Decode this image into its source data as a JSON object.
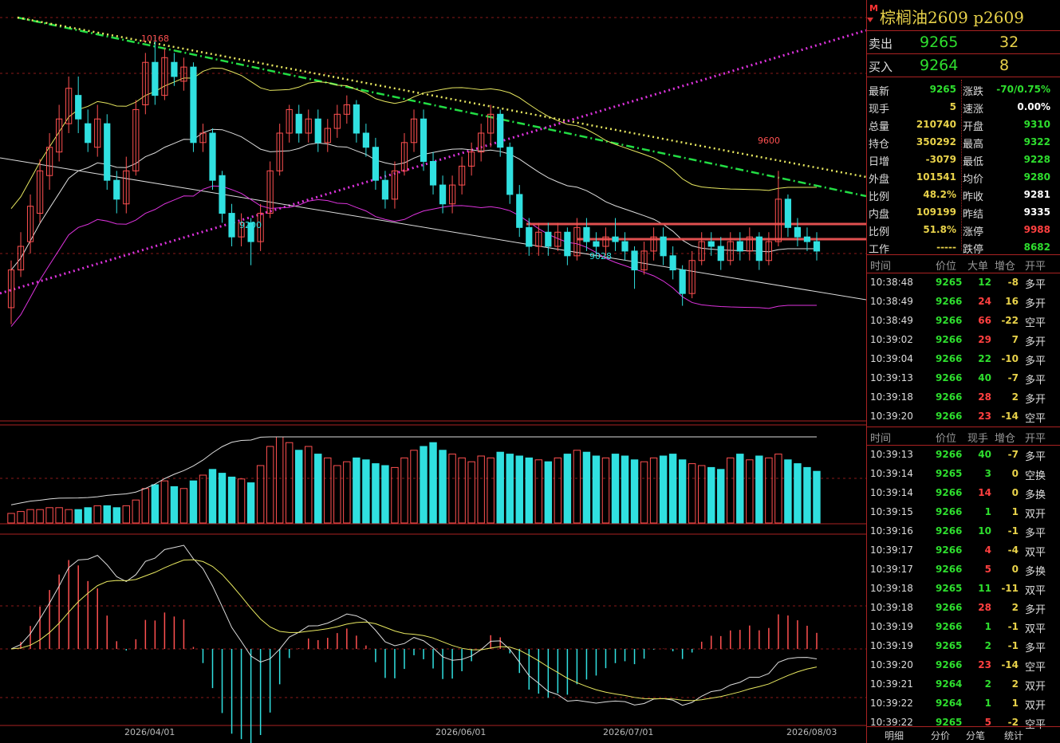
{
  "header": {
    "mark": "M",
    "title": "棕榈油2609  p2609"
  },
  "order_book": {
    "sell": {
      "label": "卖出",
      "price": "9265",
      "qty": "32"
    },
    "buy": {
      "label": "买入",
      "price": "9264",
      "qty": "8"
    }
  },
  "stats_left": [
    {
      "k": "最新",
      "v": "9265",
      "color": "#2ede2e"
    },
    {
      "k": "现手",
      "v": "5",
      "color": "#e8d24a"
    },
    {
      "k": "总量",
      "v": "210740",
      "color": "#e8d24a"
    },
    {
      "k": "持仓",
      "v": "350292",
      "color": "#e8d24a"
    },
    {
      "k": "日增",
      "v": "-3079",
      "color": "#e8d24a"
    },
    {
      "k": "外盘",
      "v": "101541",
      "color": "#e8d24a"
    },
    {
      "k": "比例",
      "v": "48.2%",
      "color": "#e8d24a"
    },
    {
      "k": "内盘",
      "v": "109199",
      "color": "#e8d24a"
    },
    {
      "k": "比例",
      "v": "51.8%",
      "color": "#e8d24a"
    },
    {
      "k": "工作",
      "v": "-----",
      "color": "#e8d24a"
    }
  ],
  "stats_right": [
    {
      "k": "涨跌",
      "v": "-70/0.75%",
      "color": "#2ede2e"
    },
    {
      "k": "速涨",
      "v": "0.00%",
      "color": "#ffffff"
    },
    {
      "k": "开盘",
      "v": "9310",
      "color": "#2ede2e"
    },
    {
      "k": "最高",
      "v": "9322",
      "color": "#2ede2e"
    },
    {
      "k": "最低",
      "v": "9228",
      "color": "#2ede2e"
    },
    {
      "k": "均价",
      "v": "9280",
      "color": "#2ede2e"
    },
    {
      "k": "昨收",
      "v": "9281",
      "color": "#ffffff"
    },
    {
      "k": "昨结",
      "v": "9335",
      "color": "#ffffff"
    },
    {
      "k": "涨停",
      "v": "9988",
      "color": "#ff4040"
    },
    {
      "k": "跌停",
      "v": "8682",
      "color": "#2ede2e"
    }
  ],
  "big_orders": {
    "headers": [
      "时间",
      "价位",
      "大单",
      "增仓",
      "开平"
    ],
    "rows": [
      {
        "time": "10:38:48",
        "price": "9265",
        "vol": "12",
        "chg": "-8",
        "type": "多平",
        "volc": "#2ede2e",
        "chgc": "#e8d24a"
      },
      {
        "time": "10:38:49",
        "price": "9266",
        "vol": "24",
        "chg": "16",
        "type": "多开",
        "volc": "#ff4040",
        "chgc": "#e8d24a"
      },
      {
        "time": "10:38:49",
        "price": "9266",
        "vol": "66",
        "chg": "-22",
        "type": "空平",
        "volc": "#ff4040",
        "chgc": "#e8d24a"
      },
      {
        "time": "10:39:02",
        "price": "9266",
        "vol": "29",
        "chg": "7",
        "type": "多开",
        "volc": "#ff4040",
        "chgc": "#e8d24a"
      },
      {
        "time": "10:39:04",
        "price": "9266",
        "vol": "22",
        "chg": "-10",
        "type": "多平",
        "volc": "#2ede2e",
        "chgc": "#e8d24a"
      },
      {
        "time": "10:39:13",
        "price": "9266",
        "vol": "40",
        "chg": "-7",
        "type": "多平",
        "volc": "#2ede2e",
        "chgc": "#e8d24a"
      },
      {
        "time": "10:39:18",
        "price": "9266",
        "vol": "28",
        "chg": "2",
        "type": "多开",
        "volc": "#ff4040",
        "chgc": "#e8d24a"
      },
      {
        "time": "10:39:20",
        "price": "9266",
        "vol": "23",
        "chg": "-14",
        "type": "空平",
        "volc": "#ff4040",
        "chgc": "#e8d24a"
      }
    ]
  },
  "ticks": {
    "headers": [
      "时间",
      "价位",
      "现手",
      "增仓",
      "开平"
    ],
    "rows": [
      {
        "time": "10:39:13",
        "price": "9266",
        "vol": "40",
        "chg": "-7",
        "type": "多平",
        "volc": "#2ede2e"
      },
      {
        "time": "10:39:14",
        "price": "9265",
        "vol": "3",
        "chg": "0",
        "type": "空换",
        "volc": "#2ede2e"
      },
      {
        "time": "10:39:14",
        "price": "9266",
        "vol": "14",
        "chg": "0",
        "type": "多换",
        "volc": "#ff4040"
      },
      {
        "time": "10:39:15",
        "price": "9266",
        "vol": "1",
        "chg": "1",
        "type": "双开",
        "volc": "#2ede2e"
      },
      {
        "time": "10:39:16",
        "price": "9266",
        "vol": "10",
        "chg": "-1",
        "type": "多平",
        "volc": "#2ede2e"
      },
      {
        "time": "10:39:17",
        "price": "9266",
        "vol": "4",
        "chg": "-4",
        "type": "双平",
        "volc": "#ff4040"
      },
      {
        "time": "10:39:17",
        "price": "9266",
        "vol": "5",
        "chg": "0",
        "type": "多换",
        "volc": "#ff4040"
      },
      {
        "time": "10:39:18",
        "price": "9265",
        "vol": "11",
        "chg": "-11",
        "type": "双平",
        "volc": "#2ede2e"
      },
      {
        "time": "10:39:18",
        "price": "9266",
        "vol": "28",
        "chg": "2",
        "type": "多开",
        "volc": "#ff4040"
      },
      {
        "time": "10:39:19",
        "price": "9266",
        "vol": "1",
        "chg": "-1",
        "type": "双平",
        "volc": "#2ede2e"
      },
      {
        "time": "10:39:19",
        "price": "9265",
        "vol": "2",
        "chg": "-1",
        "type": "多平",
        "volc": "#2ede2e"
      },
      {
        "time": "10:39:20",
        "price": "9266",
        "vol": "23",
        "chg": "-14",
        "type": "空平",
        "volc": "#ff4040"
      },
      {
        "time": "10:39:21",
        "price": "9264",
        "vol": "2",
        "chg": "2",
        "type": "双开",
        "volc": "#2ede2e"
      },
      {
        "time": "10:39:22",
        "price": "9264",
        "vol": "1",
        "chg": "1",
        "type": "双开",
        "volc": "#2ede2e"
      },
      {
        "time": "10:39:22",
        "price": "9265",
        "vol": "5",
        "chg": "-2",
        "type": "空平",
        "volc": "#ff4040"
      }
    ]
  },
  "tabs": [
    "明细",
    "分价",
    "分笔",
    "统计"
  ],
  "chart_labels": {
    "high_a": "10168",
    "high_b": "9600",
    "low_a": "9200",
    "low_b": "9028"
  },
  "dates": [
    "2026/04/01",
    "2026/06/01",
    "2026/07/01",
    "2026/08/03"
  ],
  "chart_data": {
    "type": "candlestick",
    "price_range": [
      8550,
      10250
    ],
    "candles": [
      [
        9020,
        9180,
        8950,
        9220
      ],
      [
        9180,
        9280,
        9150,
        9340
      ],
      [
        9300,
        9450,
        9250,
        9500
      ],
      [
        9420,
        9600,
        9380,
        9650
      ],
      [
        9580,
        9700,
        9520,
        9760
      ],
      [
        9680,
        9820,
        9640,
        9880
      ],
      [
        9800,
        9950,
        9760,
        10000
      ],
      [
        9920,
        9820,
        9760,
        10000
      ],
      [
        9800,
        9720,
        9680,
        9860
      ],
      [
        9700,
        9820,
        9660,
        9880
      ],
      [
        9800,
        9560,
        9520,
        9840
      ],
      [
        9560,
        9480,
        9420,
        9600
      ],
      [
        9460,
        9600,
        9420,
        9660
      ],
      [
        9600,
        9860,
        9580,
        9900
      ],
      [
        9880,
        10060,
        9840,
        10100
      ],
      [
        10060,
        9920,
        9880,
        10168
      ],
      [
        9920,
        10080,
        9900,
        10120
      ],
      [
        10060,
        10000,
        9960,
        10100
      ],
      [
        9980,
        10040,
        9940,
        10080
      ],
      [
        10040,
        9720,
        9680,
        10060
      ],
      [
        9720,
        9760,
        9680,
        9800
      ],
      [
        9760,
        9560,
        9520,
        9780
      ],
      [
        9580,
        9420,
        9380,
        9600
      ],
      [
        9420,
        9320,
        9280,
        9460
      ],
      [
        9320,
        9380,
        9280,
        9420
      ],
      [
        9380,
        9300,
        9200,
        9400
      ],
      [
        9300,
        9420,
        9260,
        9460
      ],
      [
        9420,
        9600,
        9400,
        9640
      ],
      [
        9600,
        9760,
        9580,
        9800
      ],
      [
        9760,
        9860,
        9720,
        9880
      ],
      [
        9840,
        9760,
        9720,
        9880
      ],
      [
        9760,
        9820,
        9720,
        9860
      ],
      [
        9820,
        9720,
        9680,
        9860
      ],
      [
        9720,
        9780,
        9680,
        9820
      ],
      [
        9780,
        9840,
        9740,
        9880
      ],
      [
        9840,
        9880,
        9800,
        9920
      ],
      [
        9880,
        9760,
        9720,
        9900
      ],
      [
        9760,
        9700,
        9660,
        9800
      ],
      [
        9700,
        9560,
        9520,
        9740
      ],
      [
        9560,
        9480,
        9440,
        9600
      ],
      [
        9480,
        9600,
        9440,
        9640
      ],
      [
        9600,
        9720,
        9580,
        9760
      ],
      [
        9720,
        9820,
        9680,
        9860
      ],
      [
        9820,
        9640,
        9600,
        9860
      ],
      [
        9640,
        9540,
        9500,
        9680
      ],
      [
        9540,
        9460,
        9420,
        9580
      ],
      [
        9460,
        9540,
        9420,
        9580
      ],
      [
        9540,
        9620,
        9500,
        9660
      ],
      [
        9620,
        9680,
        9580,
        9720
      ],
      [
        9680,
        9760,
        9640,
        9800
      ],
      [
        9760,
        9840,
        9700,
        9880
      ],
      [
        9840,
        9700,
        9660,
        9860
      ],
      [
        9700,
        9500,
        9460,
        9720
      ],
      [
        9500,
        9360,
        9320,
        9540
      ],
      [
        9360,
        9280,
        9240,
        9400
      ],
      [
        9280,
        9340,
        9240,
        9380
      ],
      [
        9340,
        9280,
        9240,
        9380
      ],
      [
        9280,
        9340,
        9260,
        9380
      ],
      [
        9340,
        9240,
        9200,
        9360
      ],
      [
        9240,
        9360,
        9220,
        9400
      ],
      [
        9360,
        9300,
        9260,
        9400
      ],
      [
        9300,
        9280,
        9240,
        9340
      ],
      [
        9280,
        9320,
        9240,
        9360
      ],
      [
        9320,
        9300,
        9260,
        9400
      ],
      [
        9300,
        9260,
        9220,
        9340
      ],
      [
        9260,
        9180,
        9100,
        9280
      ],
      [
        9180,
        9260,
        9160,
        9300
      ],
      [
        9260,
        9320,
        9220,
        9360
      ],
      [
        9320,
        9240,
        9200,
        9360
      ],
      [
        9240,
        9180,
        9140,
        9280
      ],
      [
        9180,
        9080,
        9028,
        9200
      ],
      [
        9080,
        9220,
        9060,
        9260
      ],
      [
        9220,
        9300,
        9200,
        9340
      ],
      [
        9300,
        9280,
        9240,
        9340
      ],
      [
        9280,
        9220,
        9180,
        9320
      ],
      [
        9220,
        9300,
        9200,
        9340
      ],
      [
        9300,
        9260,
        9220,
        9340
      ],
      [
        9260,
        9320,
        9220,
        9360
      ],
      [
        9320,
        9220,
        9180,
        9340
      ],
      [
        9220,
        9300,
        9200,
        9340
      ],
      [
        9300,
        9480,
        9280,
        9600
      ],
      [
        9480,
        9360,
        9320,
        9500
      ],
      [
        9360,
        9320,
        9280,
        9400
      ],
      [
        9320,
        9300,
        9260,
        9360
      ],
      [
        9300,
        9260,
        9220,
        9340
      ]
    ],
    "volumes": [
      5,
      6,
      7,
      7,
      8,
      8,
      7,
      7,
      8,
      9,
      9,
      8,
      9,
      12,
      18,
      20,
      22,
      19,
      18,
      22,
      25,
      28,
      26,
      24,
      23,
      21,
      30,
      40,
      45,
      42,
      38,
      40,
      36,
      34,
      30,
      32,
      34,
      33,
      31,
      30,
      29,
      34,
      38,
      40,
      42,
      38,
      36,
      34,
      32,
      35,
      34,
      37,
      36,
      35,
      34,
      33,
      32,
      34,
      36,
      38,
      37,
      35,
      34,
      36,
      35,
      33,
      32,
      34,
      35,
      36,
      33,
      31,
      30,
      29,
      28,
      34,
      36,
      33,
      35,
      34,
      36,
      33,
      31,
      29,
      27
    ],
    "price_series_labels": [
      "10168",
      "9600",
      "9200",
      "9028"
    ]
  }
}
